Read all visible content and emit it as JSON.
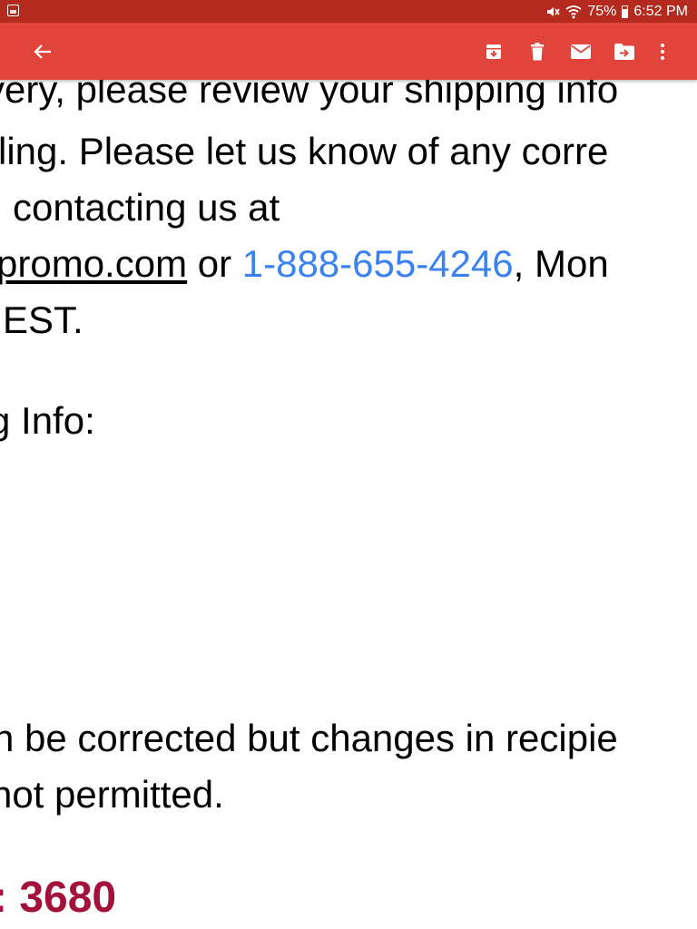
{
  "status_bar": {
    "battery": "75%",
    "time": "6:52 PM"
  },
  "toolbar": {
    "back_icon": "arrow-left-icon",
    "actions": [
      "archive-icon",
      "trash-icon",
      "mail-icon",
      "move-to-folder-icon",
      "more-vert-icon"
    ]
  },
  "message": {
    "line1": "very, please review your shipping info",
    "line2": "ling. Please let us know of any corre",
    "line3": "contacting us at",
    "email_partial": "promo.com",
    "or_text": " or ",
    "phone": "1-888-655-4246",
    "after_phone": ", Mon",
    "line5": "EST.",
    "line6": "g Info:",
    "line7": "n be corrected but changes in recipie",
    "line8": "not permitted.",
    "line9": ": 3680"
  },
  "colors": {
    "status_bar": "#b52a1f",
    "toolbar": "#e0443a",
    "link_phone": "#3b82f0",
    "number_accent": "#a3123b"
  }
}
